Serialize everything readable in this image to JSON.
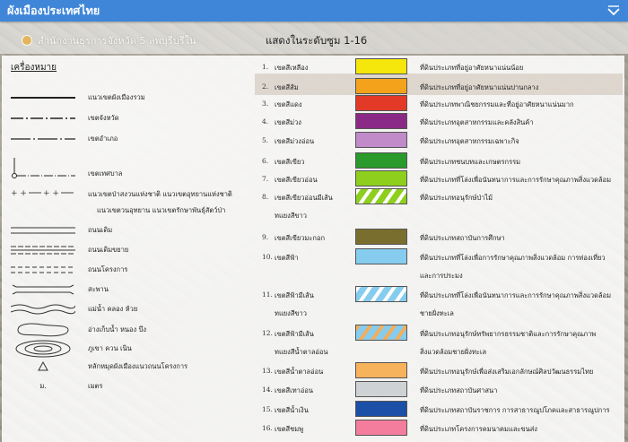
{
  "header": {
    "title": "ผังเมืองประเทศไทย",
    "toggle_icon": "chevron-down-icon"
  },
  "office": {
    "label": "สำนักงานธุรการจังหวัด 5 ลพบุรีบุรีใน",
    "icon": "office-icon"
  },
  "zoom_note": "แสดงในระดับซูม 1-16",
  "legend": {
    "heading": "เครื่องหมาย",
    "symbols": [
      {
        "label": "แนวเขตผังเมืองรวม",
        "icon": "thick-line-icon"
      },
      {
        "label": "เขตจังหวัด",
        "icon": "dash-line-icon"
      },
      {
        "label": "เขตอำเภอ",
        "icon": "long-dash-line-icon"
      },
      {
        "label": "เขตเทศบาล",
        "icon": "municipal-line-icon"
      },
      {
        "label": "แนวเขตป่าสงวนแห่งชาติ แนวเขตอุทยานแห่งชาติ",
        "label2": "แนวเขตวนอุทยาน แนวเขตรักษาพันธุ์สัตว์ป่า",
        "icon": "plus-dash-line-icon"
      },
      {
        "label": "ถนนเดิม",
        "icon": "double-line-icon"
      },
      {
        "label": "ถนนเดิมขยาย",
        "icon": "double-dash-line-icon"
      },
      {
        "label": "ถนนโครงการ",
        "icon": "project-road-icon"
      },
      {
        "label": "สะพาน",
        "icon": "bridge-icon"
      },
      {
        "label": "แม่น้ำ คลอง ห้วย",
        "icon": "river-icon"
      },
      {
        "label": "อ่างเก็บน้ำ หนอง บึง",
        "icon": "reservoir-icon"
      },
      {
        "label": "ภูเขา ควน เนิน",
        "icon": "mountain-icon"
      },
      {
        "label": "หลักหมุดผังเมืองแนวถนนโครงการ",
        "icon": "triangle-marker-icon"
      },
      {
        "label": "เมตร",
        "prefix": "ม.",
        "icon": "meter-text"
      }
    ]
  },
  "zones": [
    {
      "num": "1.",
      "name": "เขตสีเหลือง",
      "color": "#f5e60c",
      "pattern": "solid",
      "desc": "ที่ดินประเภทที่อยู่อาศัยหนาแน่นน้อย"
    },
    {
      "num": "2.",
      "name": "เขตสีส้ม",
      "color": "#f4a21c",
      "pattern": "solid",
      "desc": "ที่ดินประเภทที่อยู่อาศัยหนาแน่นปานกลาง"
    },
    {
      "num": "3.",
      "name": "เขตสีแดง",
      "color": "#e23a27",
      "pattern": "solid",
      "desc": "ที่ดินประเภทพาณิชยกรรมและที่อยู่อาศัยหนาแน่นมาก"
    },
    {
      "num": "4.",
      "name": "เขตสีม่วง",
      "color": "#8b2a86",
      "pattern": "solid",
      "desc": "ที่ดินประเภทอุตสาหกรรมและคลังสินค้า"
    },
    {
      "num": "5.",
      "name": "เขตสีม่วงอ่อน",
      "color": "#c08bc8",
      "pattern": "solid",
      "desc": "ที่ดินประเภทอุตสาหกรรมเฉพาะกิจ"
    },
    {
      "num": "6.",
      "name": "เขตสีเขียว",
      "color": "#2a9a2c",
      "pattern": "solid",
      "desc": "ที่ดินประเภทชนบทและเกษตรกรรม"
    },
    {
      "num": "7.",
      "name": "เขตสีเขียวอ่อน",
      "color": "#8ecf1e",
      "pattern": "solid",
      "desc": "ที่ดินประเภทที่โล่งเพื่อนันทนาการและการรักษาคุณภาพสิ่งแวดล้อม"
    },
    {
      "num": "8.",
      "name": "เขตสีเขียวอ่อนมีเส้น",
      "name2": "ทแยงสีขาว",
      "color": "#8ecf1e",
      "pattern": "hatch-white",
      "desc": "ที่ดินประเภทอนุรักษ์ป่าไม้"
    },
    {
      "num": "9.",
      "name": "เขตสีเขียวมะกอก",
      "color": "#7a6e2e",
      "pattern": "solid",
      "desc": "ที่ดินประเภทสถาบันการศึกษา"
    },
    {
      "num": "10.",
      "name": "เขตสีฟ้า",
      "color": "#86ccef",
      "pattern": "solid",
      "desc": "ที่ดินประเภทที่โล่งเพื่อการรักษาคุณภาพสิ่งแวดล้อม การท่องเที่ยว",
      "desc2": "และการประมง"
    },
    {
      "num": "11.",
      "name": "เขตสีฟ้ามีเส้น",
      "name2": "ทแยงสีขาว",
      "color": "#86ccef",
      "pattern": "hatch-white",
      "desc": "ที่ดินประเภทที่โล่งเพื่อนันทนาการและการรักษาคุณภาพสิ่งแวดล้อม",
      "desc2": "ชายฝั่งทะเล"
    },
    {
      "num": "12.",
      "name": "เขตสีฟ้ามีเส้น",
      "name2": "ทแยงสีน้ำตาลอ่อน",
      "color": "#86ccef",
      "pattern": "hatch-brown",
      "desc": "ที่ดินประเภทอนุรักษ์ทรัพยากรธรรมชาติและการรักษาคุณภาพ",
      "desc2": "สิ่งแวดล้อมชายฝั่งทะเล"
    },
    {
      "num": "13.",
      "name": "เขตสีน้ำตาลอ่อน",
      "color": "#f7b25c",
      "pattern": "solid",
      "desc": "ที่ดินประเภทอนุรักษ์เพื่อส่งเสริมเอกลักษณ์ศิลปวัฒนธรรมไทย"
    },
    {
      "num": "14.",
      "name": "เขตสีเทาอ่อน",
      "color": "#cfd2d4",
      "pattern": "solid",
      "desc": "ที่ดินประเภทสถาบันศาสนา"
    },
    {
      "num": "15.",
      "name": "เขตสีน้ำเงิน",
      "color": "#1c4fa6",
      "pattern": "solid",
      "desc": "ที่ดินประเภทสถาบันราชการ การสาธารณูปโภคและสาธารณูปการ"
    },
    {
      "num": "16.",
      "name": "เขตสีชมพู",
      "color": "#f47c9c",
      "pattern": "solid",
      "desc": "ที่ดินประเภทโครงการคมนาคมและขนส่ง"
    }
  ]
}
